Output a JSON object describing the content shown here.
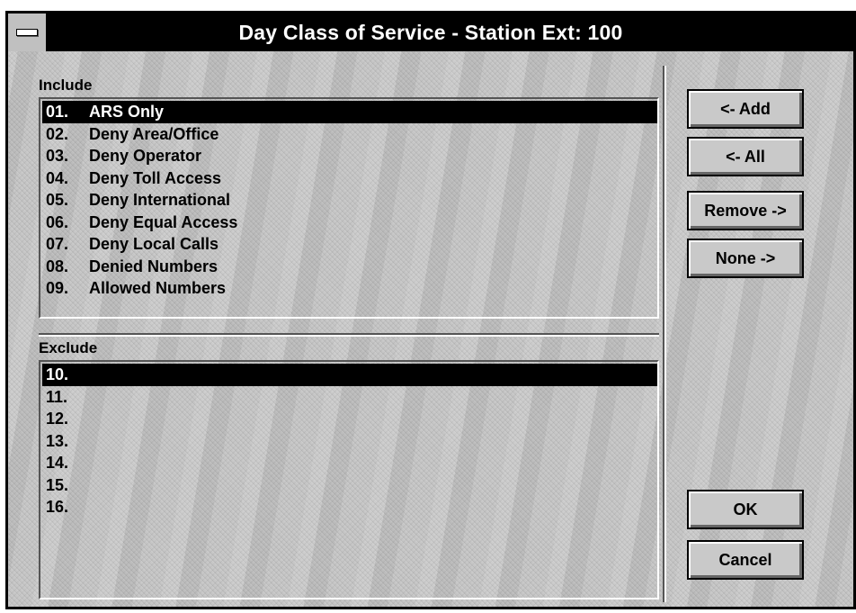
{
  "window": {
    "title": "Day Class of Service - Station Ext:  100"
  },
  "include": {
    "label": "Include",
    "items": [
      {
        "num": "01.",
        "label": "ARS Only",
        "selected": true
      },
      {
        "num": "02.",
        "label": "Deny Area/Office",
        "selected": false
      },
      {
        "num": "03.",
        "label": "Deny Operator",
        "selected": false
      },
      {
        "num": "04.",
        "label": "Deny Toll Access",
        "selected": false
      },
      {
        "num": "05.",
        "label": "Deny International",
        "selected": false
      },
      {
        "num": "06.",
        "label": "Deny Equal Access",
        "selected": false
      },
      {
        "num": "07.",
        "label": "Deny Local Calls",
        "selected": false
      },
      {
        "num": "08.",
        "label": "Denied Numbers",
        "selected": false
      },
      {
        "num": "09.",
        "label": "Allowed Numbers",
        "selected": false
      }
    ]
  },
  "exclude": {
    "label": "Exclude",
    "items": [
      {
        "num": "10.",
        "label": "",
        "selected": true
      },
      {
        "num": "11.",
        "label": "",
        "selected": false
      },
      {
        "num": "12.",
        "label": "",
        "selected": false
      },
      {
        "num": "13.",
        "label": "",
        "selected": false
      },
      {
        "num": "14.",
        "label": "",
        "selected": false
      },
      {
        "num": "15.",
        "label": "",
        "selected": false
      },
      {
        "num": "16.",
        "label": "",
        "selected": false
      }
    ]
  },
  "buttons": {
    "add": "<- Add",
    "all": "<- All",
    "remove": "Remove ->",
    "none": "None ->",
    "ok": "OK",
    "cancel": "Cancel"
  }
}
